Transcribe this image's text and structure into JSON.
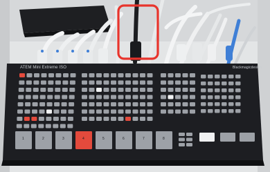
{
  "panel": {
    "model_label": "ATEM Mini Extreme ISO",
    "brand_label": "Blackmagicdesign"
  },
  "highlight": {
    "color": "#e8342c"
  },
  "bottom_row": {
    "keys": [
      "1",
      "2",
      "3",
      "4",
      "5",
      "6",
      "7",
      "8"
    ],
    "active_key_index": 3
  },
  "colors": {
    "panel_body": "#1d1e22",
    "button_grey": "#9da1a7",
    "button_red": "#e34a3c",
    "button_white": "#f0f1f2",
    "wall": "#d9dbdc",
    "desk": "#e4e6e7",
    "cable_blue": "#3f7fd6"
  }
}
